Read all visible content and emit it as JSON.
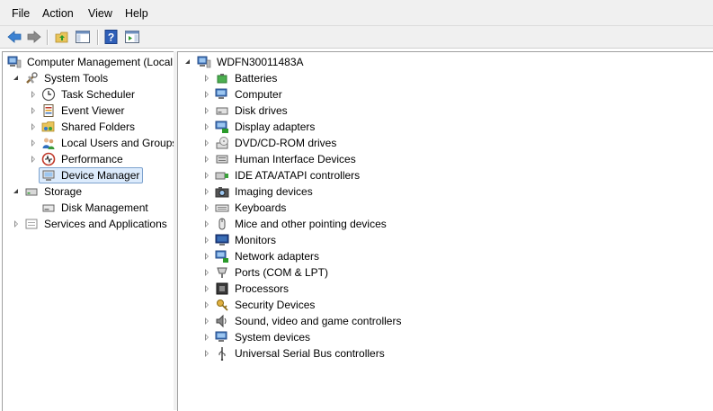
{
  "menu": [
    "File",
    "Action",
    "View",
    "Help"
  ],
  "toolbar": {
    "back_icon": "back-arrow-icon",
    "forward_icon": "forward-arrow-icon",
    "up_icon": "up-folder-icon",
    "console_tree_icon": "show-hide-console-tree-icon",
    "help_icon": "help-icon",
    "action_pane_icon": "show-hide-action-pane-icon"
  },
  "tree": {
    "root": "Computer Management (Local",
    "system_tools": "System Tools",
    "system_tools_items": [
      "Task Scheduler",
      "Event Viewer",
      "Shared Folders",
      "Local Users and Groups",
      "Performance",
      "Device Manager"
    ],
    "selected": "Device Manager",
    "storage": "Storage",
    "storage_items": [
      "Disk Management"
    ],
    "services": "Services and Applications"
  },
  "devices": {
    "computer_name": "WDFN30011483A",
    "categories": [
      "Batteries",
      "Computer",
      "Disk drives",
      "Display adapters",
      "DVD/CD-ROM drives",
      "Human Interface Devices",
      "IDE ATA/ATAPI controllers",
      "Imaging devices",
      "Keyboards",
      "Mice and other pointing devices",
      "Monitors",
      "Network adapters",
      "Ports (COM & LPT)",
      "Processors",
      "Security Devices",
      "Sound, video and game controllers",
      "System devices",
      "Universal Serial Bus controllers"
    ],
    "icons": [
      "battery-icon",
      "computer-icon",
      "disk-drive-icon",
      "display-adapter-icon",
      "dvd-drive-icon",
      "hid-icon",
      "ide-controller-icon",
      "camera-icon",
      "keyboard-icon",
      "mouse-icon",
      "monitor-icon",
      "network-adapter-icon",
      "port-icon",
      "processor-icon",
      "security-key-icon",
      "speaker-icon",
      "system-device-icon",
      "usb-icon"
    ]
  },
  "colors": {
    "selection_bg": "#dcebfc",
    "selection_border": "#7da2ce",
    "chrome": "#f0f0f0"
  }
}
